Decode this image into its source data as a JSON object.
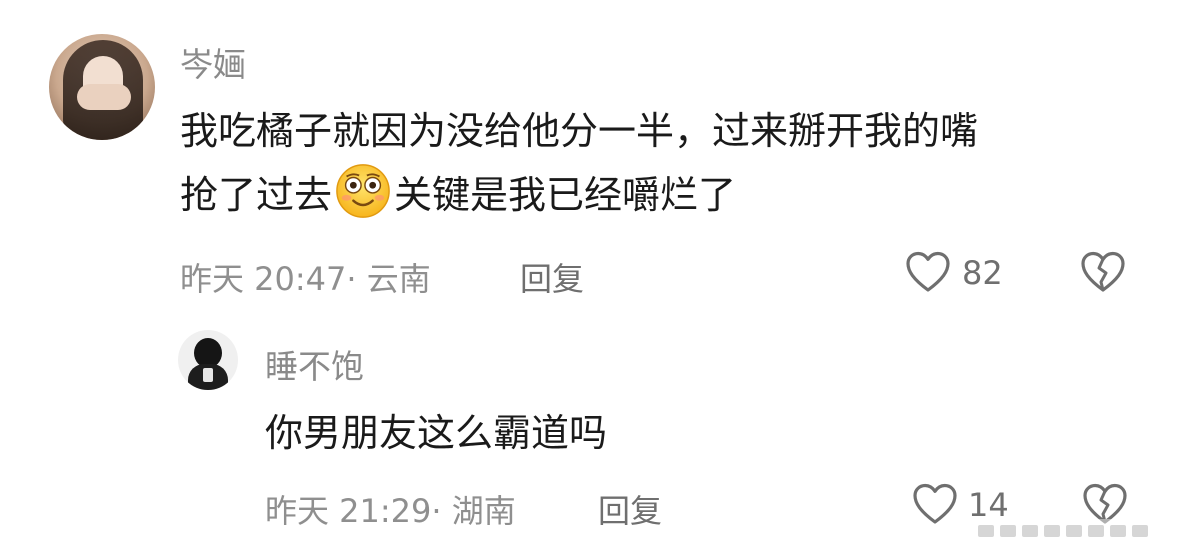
{
  "comments": [
    {
      "username": "岑婳",
      "text_line1": "我吃橘子就因为没给他分一半，过来掰开我的嘴",
      "text_line2_before": "抢了过去",
      "emoji": "smiling-face-emoji",
      "text_line2_after": "关键是我已经嚼烂了",
      "time_location": "昨天 20:47· 云南",
      "reply_label": "回复",
      "likes": "82"
    },
    {
      "username": "睡不饱",
      "text": "你男朋友这么霸道吗",
      "time_location": "昨天 21:29· 湖南",
      "reply_label": "回复",
      "likes": "14"
    }
  ],
  "colors": {
    "text": "#1a1a1a",
    "secondary": "#8f8f8f",
    "icon": "#6f6f6f",
    "background": "#ffffff"
  }
}
